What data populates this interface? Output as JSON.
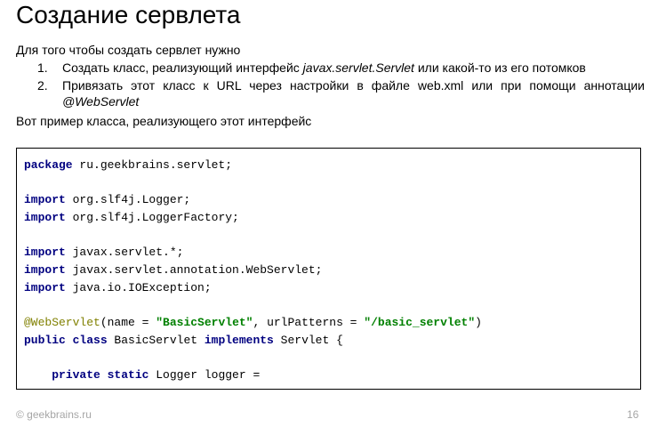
{
  "slide": {
    "title": "Создание сервлета",
    "intro": "Для того чтобы создать сервлет нужно",
    "steps": [
      {
        "number": "1.",
        "text_before": "Создать класс, реализующий интерфейс ",
        "text_em": "javax.servlet.Servlet",
        "text_after": " или  какой-то из его потомков"
      },
      {
        "number": "2.",
        "text_before": "Привязать этот класс к URL через настройки в файле web.xml или при помощи аннотации ",
        "text_em": "@WebServlet",
        "text_after": ""
      }
    ],
    "outro": "Вот пример класса, реализующего этот интерфейс"
  },
  "code": {
    "line1": {
      "kw": "package",
      "rest": " ru.geekbrains.servlet;"
    },
    "line3": {
      "kw": "import",
      "rest": " org.slf4j.Logger;"
    },
    "line4": {
      "kw": "import",
      "rest": " org.slf4j.LoggerFactory;"
    },
    "line6": {
      "kw": "import",
      "rest": " javax.servlet.*;"
    },
    "line7": {
      "kw": "import",
      "rest": " javax.servlet.annotation.WebServlet;"
    },
    "line8": {
      "kw": "import",
      "rest": " java.io.IOException;"
    },
    "line10": {
      "ann": "@WebServlet",
      "p1": "(name = ",
      "s1": "\"BasicServlet\"",
      "p2": ", urlPatterns = ",
      "s2": "\"/basic_servlet\"",
      "p3": ")"
    },
    "line11": {
      "kw1": "public class",
      "p1": " BasicServlet ",
      "kw2": "implements",
      "p2": " Servlet {"
    },
    "line13": {
      "indent": "    ",
      "kw": "private static",
      "rest": " Logger logger ="
    }
  },
  "footer": {
    "copyright": "© geekbrains.ru",
    "page_number": "16"
  },
  "colors": {
    "keyword": "#000080",
    "string": "#008000",
    "annotation": "#808000",
    "footer_text": "#a6a6a6"
  }
}
